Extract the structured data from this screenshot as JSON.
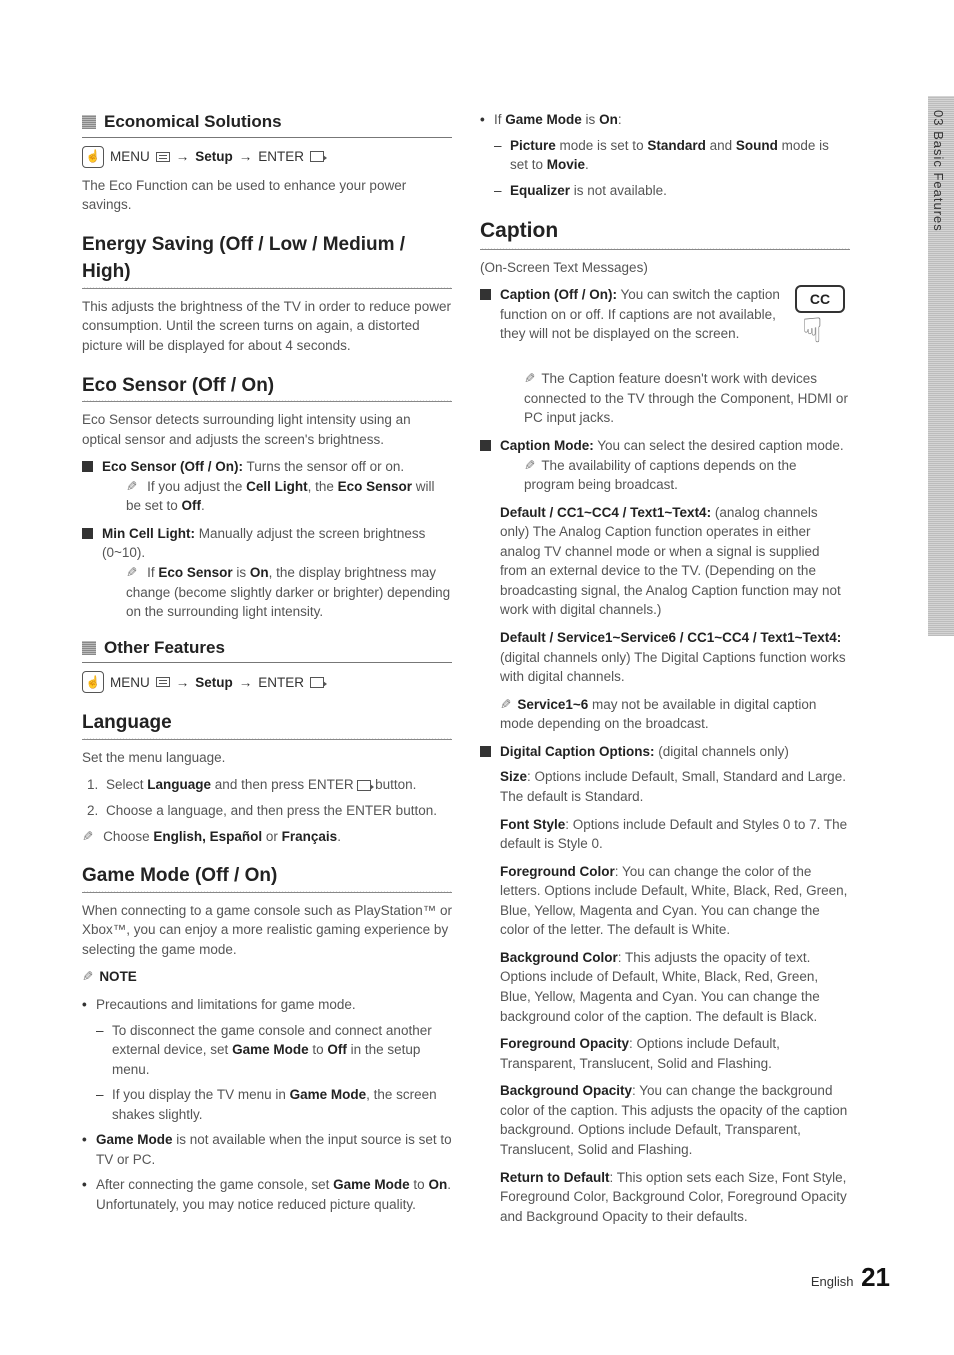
{
  "side_tab": "03  Basic Features",
  "left": {
    "sec1_title": "Economical Solutions",
    "nav1": {
      "menu": "MENU",
      "setup": "Setup",
      "enter": "ENTER"
    },
    "eco_intro": "The Eco Function can be used to enhance your power savings.",
    "energy_title": "Energy Saving (Off / Low / Medium / High)",
    "energy_body": "This adjusts the brightness of the TV in order to reduce power consumption. Until the screen turns on again, a distorted picture will be displayed for about 4 seconds.",
    "ecosensor_title": "Eco Sensor (Off / On)",
    "ecosensor_body": "Eco Sensor detects surrounding light intensity using an optical sensor and adjusts the screen's brightness.",
    "eco_item1_lead": "Eco Sensor (Off / On):",
    "eco_item1_rest": " Turns the sensor off or on.",
    "eco_item1_note_a": "If you adjust the ",
    "eco_item1_note_b": "Cell Light",
    "eco_item1_note_c": ", the ",
    "eco_item1_note_d": "Eco Sensor",
    "eco_item1_note_e": " will be set to ",
    "eco_item1_note_f": "Off",
    "eco_item1_note_g": ".",
    "eco_item2_lead": "Min Cell Light:",
    "eco_item2_rest": " Manually adjust the screen brightness (0~10).",
    "eco_item2_note_a": "If ",
    "eco_item2_note_b": "Eco Sensor",
    "eco_item2_note_c": " is ",
    "eco_item2_note_d": "On",
    "eco_item2_note_e": ", the display brightness may change (become slightly darker or brighter) depending on the surrounding light intensity.",
    "sec2_title": "Other Features",
    "lang_title": "Language",
    "lang_intro": "Set the menu language.",
    "lang_step1_a": "Select ",
    "lang_step1_b": "Language",
    "lang_step1_c": " and then press ENTER ",
    "lang_step1_d": " button.",
    "lang_step2": "Choose a language, and then press the ENTER  button.",
    "lang_note_a": "Choose ",
    "lang_note_b": "English, Español",
    "lang_note_c": " or ",
    "lang_note_d": "Français",
    "lang_note_e": ".",
    "game_title": "Game Mode (Off / On)",
    "game_intro": "When connecting to a game console such as PlayStation™ or Xbox™, you can enjoy a more realistic gaming experience by selecting the game mode.",
    "note_label": "NOTE",
    "game_b1": "Precautions and limitations for game mode.",
    "game_b1_d1_a": "To disconnect the game console and connect another external device, set ",
    "game_b1_d1_b": "Game Mode",
    "game_b1_d1_c": " to ",
    "game_b1_d1_d": "Off",
    "game_b1_d1_e": " in the setup menu.",
    "game_b1_d2_a": "If you display the TV menu in ",
    "game_b1_d2_b": "Game Mode",
    "game_b1_d2_c": ", the screen shakes slightly.",
    "game_b2_a": "Game Mode",
    "game_b2_b": " is not available when the input source is set to TV or PC.",
    "game_b3_a": "After connecting the game console, set ",
    "game_b3_b": "Game Mode",
    "game_b3_c": " to ",
    "game_b3_d": "On",
    "game_b3_e": ". Unfortunately, you may notice reduced picture quality."
  },
  "right": {
    "gm_on_a": "If ",
    "gm_on_b": "Game Mode",
    "gm_on_c": " is ",
    "gm_on_d": "On",
    "gm_on_e": ":",
    "gm_d1_a": "Picture",
    "gm_d1_b": " mode is set to ",
    "gm_d1_c": "Standard",
    "gm_d1_d": " and ",
    "gm_d1_e": "Sound",
    "gm_d1_f": " mode is set to ",
    "gm_d1_g": "Movie",
    "gm_d1_h": ".",
    "gm_d2_a": "Equalizer",
    "gm_d2_b": " is not available.",
    "caption_title": "Caption",
    "caption_sub": "(On-Screen Text Messages)",
    "cc_label": "CC",
    "cap1_lead": "Caption (Off / On):",
    "cap1_rest": " You can switch the caption function on or off. If captions are not available, they will not be displayed on the screen.",
    "cap1_note": "The Caption feature doesn't work with devices connected to the TV through the Component, HDMI or PC input jacks.",
    "cap2_lead": "Caption Mode:",
    "cap2_rest": " You can select the desired caption mode.",
    "cap2_note": "The availability of captions depends on the program being broadcast.",
    "cap2_p1_lead": "Default / CC1~CC4 / Text1~Text4:",
    "cap2_p1_rest": " (analog channels only) The Analog Caption function operates in either analog TV channel mode or when a signal is supplied from an external device to the TV. (Depending on the broadcasting signal, the Analog Caption function may not work with digital channels.)",
    "cap2_p2_lead": "Default / Service1~Service6 / CC1~CC4 / Text1~Text4:",
    "cap2_p2_rest": " (digital channels only) The Digital Captions function works with digital channels.",
    "cap2_p2_note_a": "Service1~6",
    "cap2_p2_note_b": " may not be available in digital caption mode depending on the broadcast.",
    "cap3_lead": "Digital Caption Options:",
    "cap3_rest": " (digital channels only)",
    "size_lead": "Size",
    "size_rest": ": Options include Default, Small, Standard and Large. The default is Standard.",
    "fs_lead": "Font Style",
    "fs_rest": ": Options include Default and Styles 0 to 7. The default is Style 0.",
    "fg_lead": "Foreground Color",
    "fg_rest": ": You can change the color of the letters. Options include Default, White, Black, Red, Green, Blue, Yellow, Magenta and Cyan. You can change the color of the letter. The default is White.",
    "bg_lead": "Background Color",
    "bg_rest": ": This adjusts the opacity of text. Options include of Default, White, Black, Red, Green, Blue, Yellow, Magenta and Cyan. You can change the background color of the caption. The default is Black.",
    "fo_lead": "Foreground Opacity",
    "fo_rest": ": Options include Default, Transparent, Translucent, Solid and Flashing.",
    "bo_lead": "Background Opacity",
    "bo_rest": ": You can change the background color of the caption. This adjusts the opacity of the caption background. Options include Default, Transparent, Translucent, Solid and Flashing.",
    "rd_lead": "Return to Default",
    "rd_rest": ": This option sets each Size, Font Style, Foreground Color, Background Color, Foreground Opacity and Background Opacity to their defaults."
  },
  "footer": {
    "lang": "English",
    "page": "21"
  }
}
